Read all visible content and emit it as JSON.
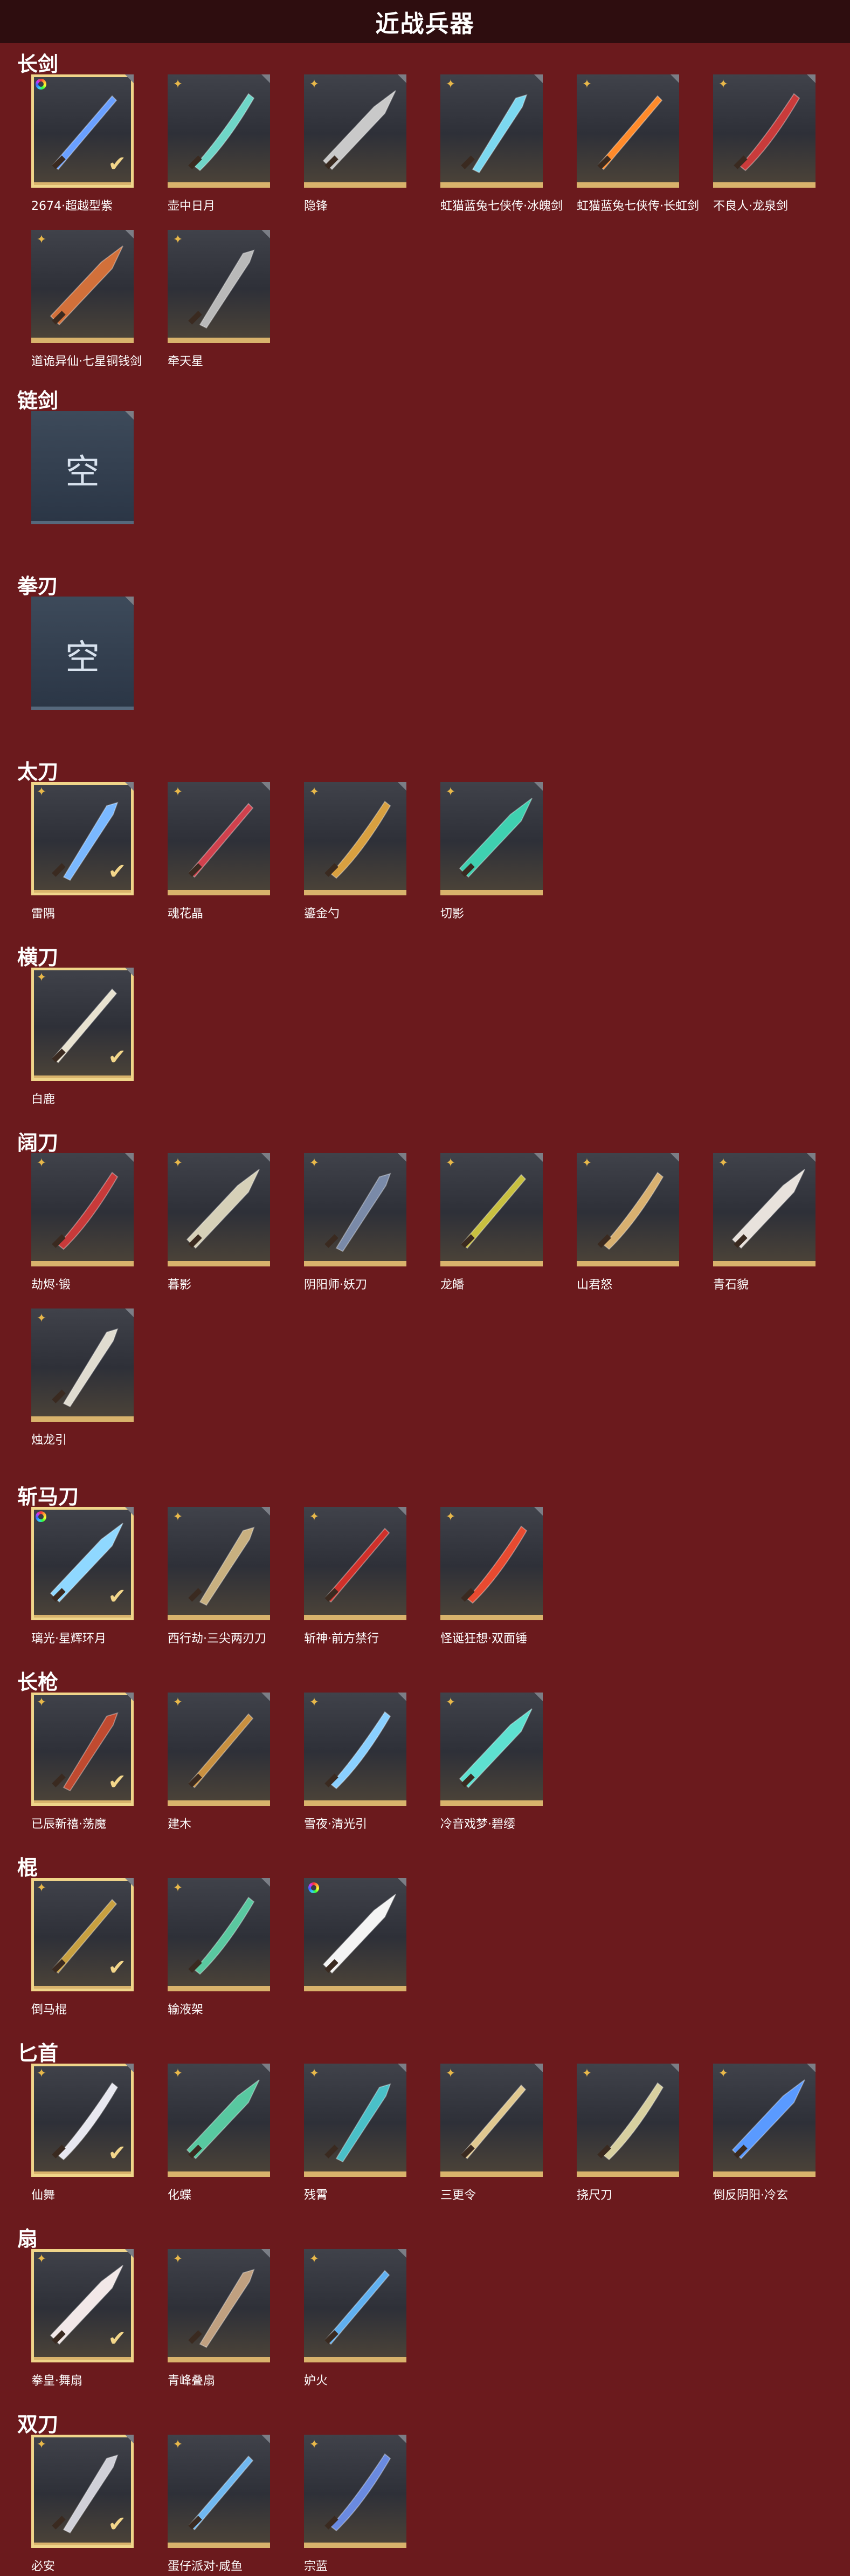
{
  "page": {
    "title": "近战兵器"
  },
  "categories": [
    {
      "name": "长剑",
      "items": [
        {
          "name": "2674·超越型紫",
          "badge": "rainbow",
          "selected": true,
          "color": "#6aa0ff"
        },
        {
          "name": "壶中日月",
          "badge": "star",
          "color": "#6fd6c8"
        },
        {
          "name": "隐锋",
          "badge": "star",
          "color": "#c9c9c9"
        },
        {
          "name": "虹猫蓝兔七侠传·冰魄剑",
          "badge": "star",
          "color": "#7cd8f0"
        },
        {
          "name": "虹猫蓝兔七侠传·长虹剑",
          "badge": "star",
          "color": "#ff8a2a"
        },
        {
          "name": "不良人·龙泉剑",
          "badge": "star",
          "color": "#c93b3b"
        },
        {
          "name": "道诡异仙·七星铜钱剑",
          "badge": "star",
          "color": "#d2703a"
        },
        {
          "name": "牵天星",
          "badge": "star",
          "color": "#b9b9b9"
        }
      ]
    },
    {
      "name": "链剑",
      "items": [
        {
          "name": "",
          "empty": true,
          "empty_text": "空"
        }
      ]
    },
    {
      "name": "拳刃",
      "items": [
        {
          "name": "",
          "empty": true,
          "empty_text": "空"
        }
      ]
    },
    {
      "name": "太刀",
      "items": [
        {
          "name": "雷隅",
          "badge": "star",
          "selected": true,
          "color": "#7ab8ff"
        },
        {
          "name": "魂花晶",
          "badge": "star",
          "color": "#d0414d"
        },
        {
          "name": "鎏金勺",
          "badge": "star",
          "color": "#d8a040"
        },
        {
          "name": "切影",
          "badge": "star",
          "color": "#3fd0b0"
        }
      ]
    },
    {
      "name": "横刀",
      "items": [
        {
          "name": "白鹿",
          "badge": "star",
          "selected": true,
          "color": "#e8e2d0"
        }
      ]
    },
    {
      "name": "阔刀",
      "items": [
        {
          "name": "劫烬·锻",
          "badge": "star",
          "color": "#c83a3a"
        },
        {
          "name": "暮影",
          "badge": "star",
          "color": "#d6d0b8"
        },
        {
          "name": "阴阳师·妖刀",
          "badge": "star",
          "color": "#7a8aa8"
        },
        {
          "name": "龙皤",
          "badge": "star",
          "color": "#c8c040"
        },
        {
          "name": "山君怒",
          "badge": "star",
          "color": "#d8b070"
        },
        {
          "name": "青石貌",
          "badge": "star",
          "color": "#e8e2dc"
        },
        {
          "name": "烛龙引",
          "badge": "star",
          "color": "#e0dcd0"
        }
      ]
    },
    {
      "name": "斩马刀",
      "items": [
        {
          "name": "璃光·星辉环月",
          "badge": "rainbow",
          "selected": true,
          "color": "#8fd8ff"
        },
        {
          "name": "西行劫·三尖两刃刀",
          "badge": "star",
          "color": "#c8b080"
        },
        {
          "name": "斩神·前方禁行",
          "badge": "star",
          "color": "#d0302a"
        },
        {
          "name": "怪诞狂想·双面锤",
          "badge": "star",
          "color": "#e84a30"
        }
      ]
    },
    {
      "name": "长枪",
      "items": [
        {
          "name": "已辰新禧·荡魔",
          "badge": "star",
          "selected": true,
          "color": "#c04a30"
        },
        {
          "name": "建木",
          "badge": "star",
          "color": "#c89040"
        },
        {
          "name": "雪夜·清光引",
          "badge": "star",
          "color": "#8ad0ff"
        },
        {
          "name": "冷音戏梦·碧缨",
          "badge": "star",
          "color": "#5ee0d0"
        }
      ]
    },
    {
      "name": "棍",
      "items": [
        {
          "name": "倒马棍",
          "badge": "star",
          "selected": true,
          "color": "#c8a040"
        },
        {
          "name": "输液架",
          "badge": "star",
          "color": "#5ac8a0"
        },
        {
          "name": "",
          "badge": "rainbow",
          "color": "#f4f4f4"
        }
      ]
    },
    {
      "name": "匕首",
      "items": [
        {
          "name": "仙舞",
          "badge": "star",
          "selected": true,
          "color": "#e8e8f0"
        },
        {
          "name": "化蝶",
          "badge": "star",
          "color": "#58c8a0"
        },
        {
          "name": "残霄",
          "badge": "star",
          "color": "#4ac0c8"
        },
        {
          "name": "三更令",
          "badge": "star",
          "color": "#e0c890"
        },
        {
          "name": "挠尺刀",
          "badge": "star",
          "color": "#d8d0a0"
        },
        {
          "name": "倒反阴阳·冷玄",
          "badge": "star",
          "color": "#5a9aff"
        }
      ]
    },
    {
      "name": "扇",
      "items": [
        {
          "name": "拳皇·舞扇",
          "badge": "star",
          "selected": true,
          "color": "#f2e8e8"
        },
        {
          "name": "青峰叠扇",
          "badge": "star",
          "color": "#c0a080"
        },
        {
          "name": "妒火",
          "badge": "star",
          "color": "#60b0f0"
        }
      ]
    },
    {
      "name": "双刀",
      "items": [
        {
          "name": "必安",
          "badge": "star",
          "selected": true,
          "color": "#d0d0d8"
        },
        {
          "name": "蛋仔派对·咸鱼",
          "badge": "star",
          "color": "#70b8f0"
        },
        {
          "name": "宗蓝",
          "badge": "star",
          "color": "#6a8ae0"
        }
      ]
    }
  ]
}
